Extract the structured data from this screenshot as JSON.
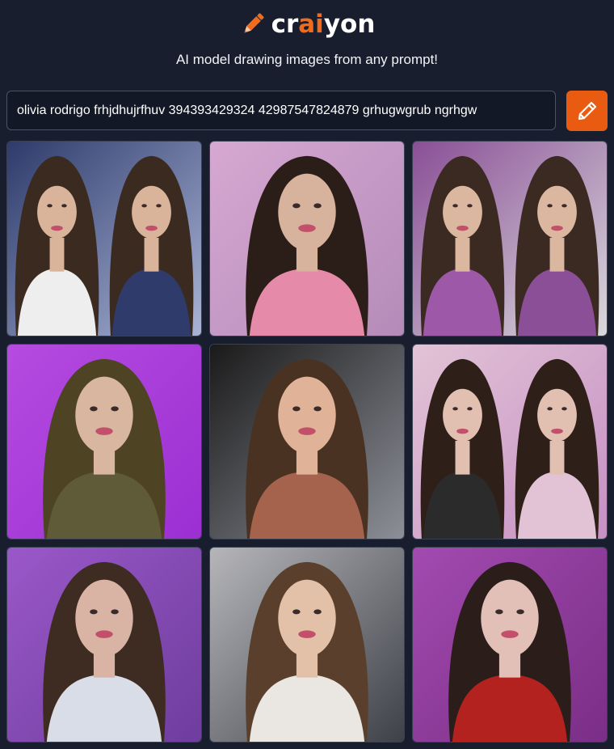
{
  "brand": {
    "name_prefix": "cr",
    "name_accent": "ai",
    "name_suffix": "yon",
    "icon": "pencil-icon",
    "accent_color": "#f26b1d"
  },
  "tagline": "AI model drawing images from any prompt!",
  "prompt": {
    "value": "olivia rodrigo frhjdhujrfhuv 394393429324 42987547824879 grhugwgrub ngrhgw",
    "placeholder": ""
  },
  "draw_button": {
    "icon": "pencil-icon",
    "color": "#ea5b12"
  },
  "colors": {
    "background": "#181e2d",
    "input_background": "#131827",
    "input_border": "#4b5264",
    "text": "#ffffff"
  },
  "results": [
    {
      "bg": "#a9b4d6",
      "accent": "#2e3b6b",
      "hair": "#3a2a20",
      "skin": "#d9b39a",
      "top": "#eeeeee",
      "subjects": 2
    },
    {
      "bg": "#b48bb8",
      "accent": "#d6a8d2",
      "hair": "#2b1d18",
      "skin": "#d7b29c",
      "top": "#e58aa8",
      "subjects": 1
    },
    {
      "bg": "#d9d9dc",
      "accent": "#8a4f96",
      "hair": "#3b2a22",
      "skin": "#dcb7a0",
      "top": "#9d58a8",
      "subjects": 2
    },
    {
      "bg": "#9c2fd2",
      "accent": "#b54be0",
      "hair": "#4e4424",
      "skin": "#d8b6a0",
      "top": "#5f5a38",
      "subjects": 1
    },
    {
      "bg": "#8d8f98",
      "accent": "#1a1a1a",
      "hair": "#4a3222",
      "skin": "#e0b398",
      "top": "#a5624c",
      "subjects": 1
    },
    {
      "bg": "#c690c4",
      "accent": "#e2c3d6",
      "hair": "#2e1f19",
      "skin": "#e1c0b2",
      "top": "#2b2b2b",
      "subjects": 2
    },
    {
      "bg": "#6e3d9e",
      "accent": "#9a58c8",
      "hair": "#3e2c22",
      "skin": "#d9b4a4",
      "top": "#d9dde8",
      "subjects": 1
    },
    {
      "bg": "#3e4148",
      "accent": "#b6b6ba",
      "hair": "#5a402c",
      "skin": "#e3c0a8",
      "top": "#eae6e2",
      "subjects": 1
    },
    {
      "bg": "#7a2e86",
      "accent": "#a24ab0",
      "hair": "#2b1d1a",
      "skin": "#e2c0b8",
      "top": "#b3221e",
      "subjects": 1
    }
  ]
}
